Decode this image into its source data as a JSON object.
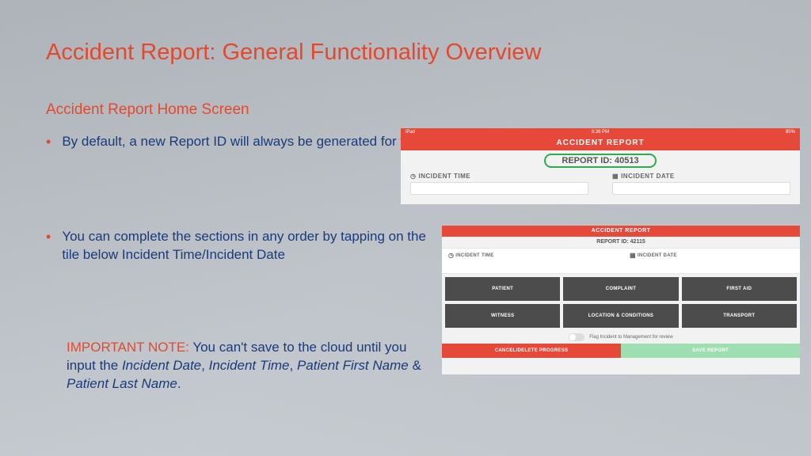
{
  "title": "Accident Report: General Functionality Overview",
  "subtitle": "Accident Report Home Screen",
  "bullets": {
    "b1": "By default, a new Report ID will always be generated for you.",
    "b2": "You can complete the sections in any order by tapping on the tile below Incident Time/Incident Date"
  },
  "note": {
    "imp": "IMPORTANT NOTE:",
    "lead": " You can't save to the cloud until you input the ",
    "f1": "Incident Date",
    "f2": "Incident Time",
    "f3": "Patient First Name",
    "f4": "Patient Last Name"
  },
  "shot1": {
    "status_left": "iPad",
    "status_center": "8:36 PM",
    "status_right": "85%",
    "header": "ACCIDENT REPORT",
    "report_id": "REPORT ID: 40513",
    "field_time": "INCIDENT TIME",
    "field_date": "INCIDENT DATE"
  },
  "shot2": {
    "header": "ACCIDENT REPORT",
    "report_id": "REPORT ID: 42115",
    "field_time": "INCIDENT TIME",
    "field_date": "INCIDENT DATE",
    "tiles": {
      "t1": "PATIENT",
      "t2": "COMPLAINT",
      "t3": "FIRST AID",
      "t4": "WITNESS",
      "t5": "LOCATION & CONDITIONS",
      "t6": "TRANSPORT"
    },
    "flag_label": "Flag Incident to Management for review",
    "btn_cancel": "CANCEL/DELETE PROGRESS",
    "btn_save": "SAVE REPORT"
  }
}
